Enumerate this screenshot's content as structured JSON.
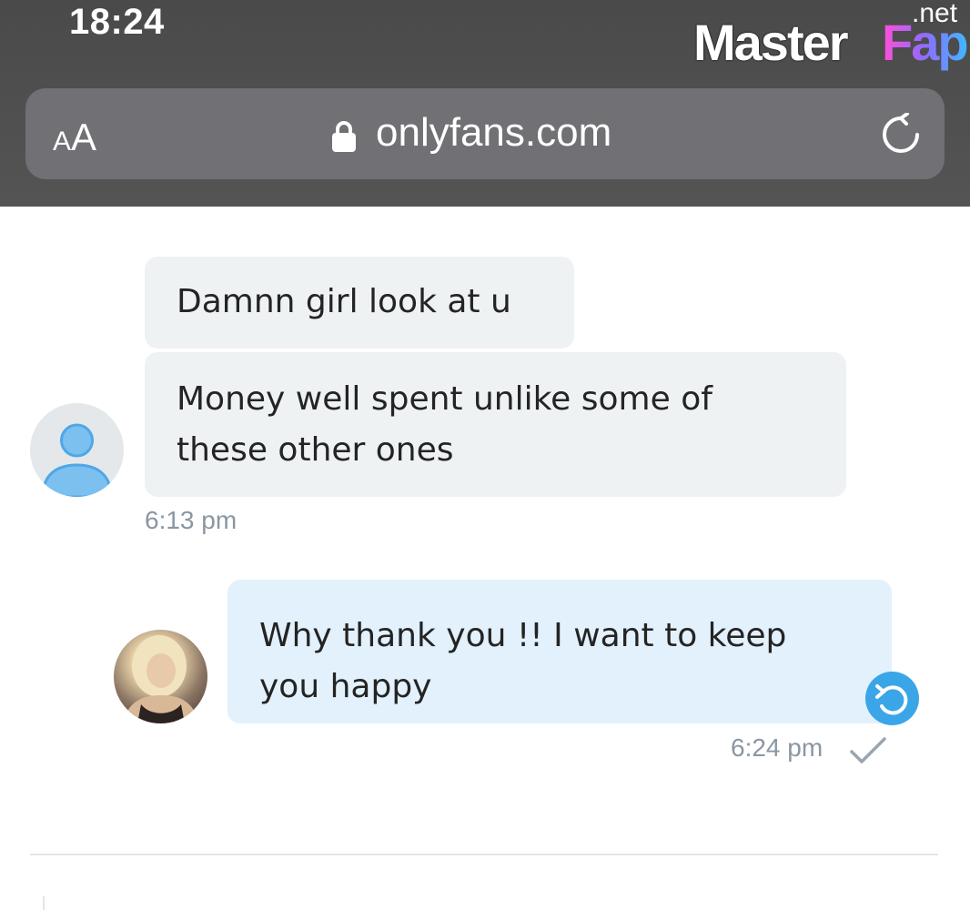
{
  "status_bar": {
    "time": "18:24"
  },
  "watermark": {
    "part1": "Master",
    "part2": "Fap",
    "suffix": ".net"
  },
  "browser": {
    "text_size_button_small": "A",
    "text_size_button_big": "A",
    "url": "onlyfans.com",
    "lock_icon": "lock-icon",
    "reload_icon": "reload-icon"
  },
  "chat": {
    "messages": [
      {
        "direction": "incoming",
        "text": "Damnn girl look at u"
      },
      {
        "direction": "incoming",
        "text_lines": [
          "Money well spent unlike some of",
          "these other ones"
        ],
        "time": "6:13 pm"
      },
      {
        "direction": "outgoing",
        "text_lines": [
          "Why thank you !! I want to keep",
          "you happy"
        ],
        "time": "6:24 pm",
        "status": "sent-check"
      }
    ]
  },
  "colors": {
    "incoming_bubble": "#eef2f3",
    "outgoing_bubble": "#e2f1fb",
    "accent": "#3aa6e8",
    "timestamp": "#8a96a3"
  }
}
